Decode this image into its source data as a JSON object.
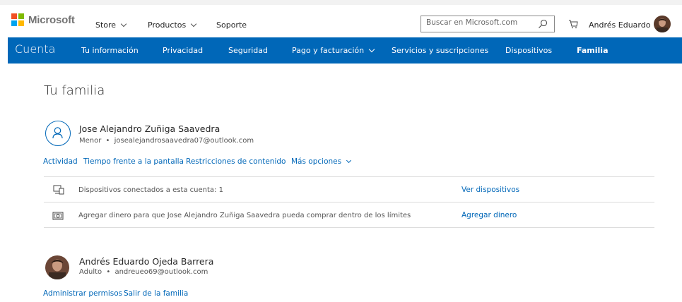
{
  "header": {
    "brand": "Microsoft",
    "logo_colors": [
      "#f25022",
      "#7fba00",
      "#00a4ef",
      "#ffb900"
    ],
    "nav": [
      {
        "label": "Store",
        "dropdown": true
      },
      {
        "label": "Productos",
        "dropdown": true
      },
      {
        "label": "Soporte",
        "dropdown": false
      }
    ],
    "search_placeholder": "Buscar en Microsoft.com",
    "user_name": "Andrés Eduardo"
  },
  "account_bar": {
    "brand": "Cuenta",
    "color": "#0067b8",
    "items": [
      {
        "label": "Tu información"
      },
      {
        "label": "Privacidad"
      },
      {
        "label": "Seguridad"
      },
      {
        "label": "Pago y facturación",
        "dropdown": true
      },
      {
        "label": "Servicios y suscripciones"
      },
      {
        "label": "Dispositivos"
      },
      {
        "label": "Familia",
        "active": true
      }
    ]
  },
  "page": {
    "title": "Tu familia",
    "members": [
      {
        "name": "Jose Alejandro Zuñiga Saavedra",
        "role": "Menor",
        "email": "josealejandrosaavedra07@outlook.com",
        "links": [
          "Actividad",
          "Tiempo frente a la pantalla",
          "Restricciones de contenido",
          "Más opciones"
        ],
        "rows": [
          {
            "icon": "devices-icon",
            "text": "Dispositivos conectados a esta cuenta: 1",
            "action": "Ver dispositivos"
          },
          {
            "icon": "money-icon",
            "text": "Agregar dinero para que Jose Alejandro Zuñiga Saavedra pueda comprar dentro de los límites",
            "action": "Agregar dinero"
          }
        ]
      },
      {
        "name": "Andrés Eduardo Ojeda Barrera",
        "role": "Adulto",
        "email": "andreueo69@outlook.com",
        "links": [
          "Administrar permisos",
          "Salir de la familia"
        ]
      }
    ]
  },
  "separator": "•"
}
